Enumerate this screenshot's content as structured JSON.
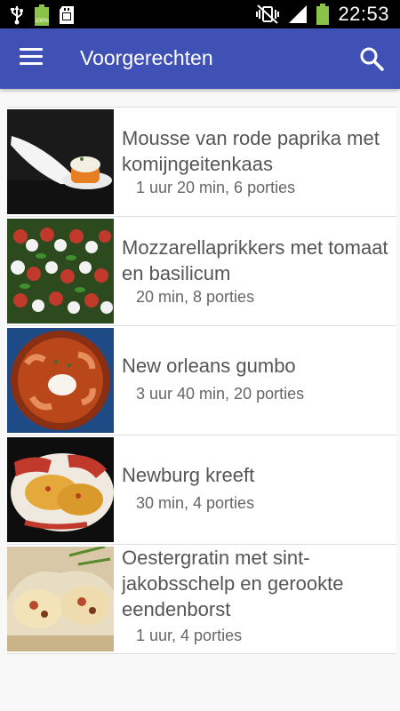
{
  "status": {
    "time": "22:53",
    "battery_pct": "100%"
  },
  "appbar": {
    "title": "Voorgerechten"
  },
  "recipes": [
    {
      "name": "Mousse van rode paprika met komijngeitenkaas",
      "meta": "1 uur 20 min, 6 porties"
    },
    {
      "name": "Mozzarellaprikkers met tomaat en basilicum",
      "meta": "20 min, 8 porties"
    },
    {
      "name": "New orleans gumbo",
      "meta": "3 uur 40 min, 20 porties"
    },
    {
      "name": "Newburg kreeft",
      "meta": "30 min, 4 porties"
    },
    {
      "name": "Oestergratin met sint-jakobsschelp en gerookte eendenborst",
      "meta": "1 uur, 4 porties"
    }
  ]
}
